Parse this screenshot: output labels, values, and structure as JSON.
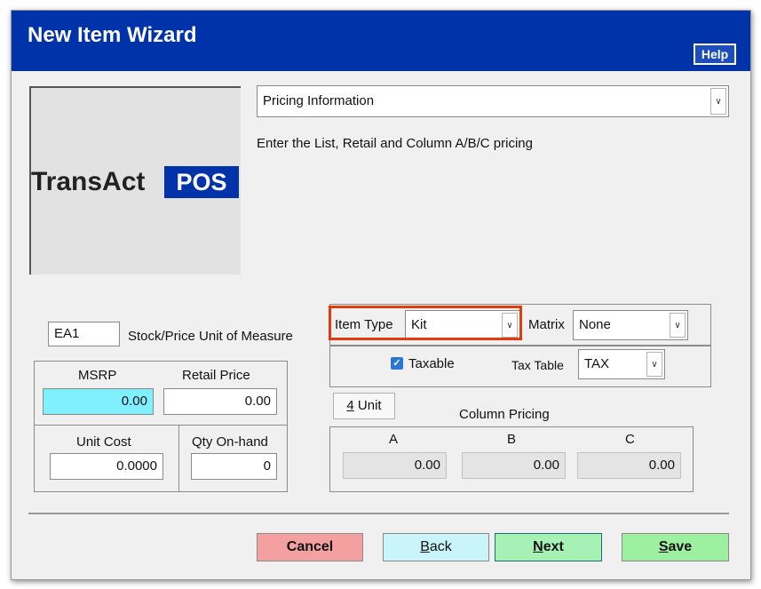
{
  "window": {
    "title": "New Item Wizard",
    "help_label": "Help"
  },
  "logo": {
    "text": "TransAct",
    "badge": "POS"
  },
  "step_select": {
    "value": "Pricing Information"
  },
  "instructions": "Enter the List, Retail and Column A/B/C pricing",
  "unit_of_measure": {
    "value": "EA1",
    "label": "Stock/Price Unit of Measure"
  },
  "item_type": {
    "label": "Item Type",
    "value": "Kit"
  },
  "matrix": {
    "label": "Matrix",
    "value": "None"
  },
  "taxable": {
    "label": "Taxable",
    "checked": true
  },
  "tax_table": {
    "label": "Tax Table",
    "value": "TAX"
  },
  "pricing": {
    "msrp_label": "MSRP",
    "msrp_value": "0.00",
    "retail_label": "Retail Price",
    "retail_value": "0.00",
    "unit_cost_label": "Unit Cost",
    "unit_cost_value": "0.0000",
    "qty_label": "Qty On-hand",
    "qty_value": "0"
  },
  "unit_button": {
    "key": "4",
    "rest": " Unit"
  },
  "column_pricing": {
    "title": "Column Pricing",
    "columns": [
      {
        "label": "A",
        "value": "0.00"
      },
      {
        "label": "B",
        "value": "0.00"
      },
      {
        "label": "C",
        "value": "0.00"
      }
    ]
  },
  "buttons": {
    "cancel": "Cancel",
    "back_key": "B",
    "back_rest": "ack",
    "next_key": "N",
    "next_rest": "ext",
    "save_key": "S",
    "save_rest": "ave"
  },
  "colors": {
    "titlebar": "#0033aa",
    "highlight": "#e03c10",
    "msrp_field": "#80f0ff",
    "cancel": "#f4a0a0",
    "back": "#c8f4fa",
    "next": "#a6f2b4",
    "save": "#9cf0a0"
  }
}
